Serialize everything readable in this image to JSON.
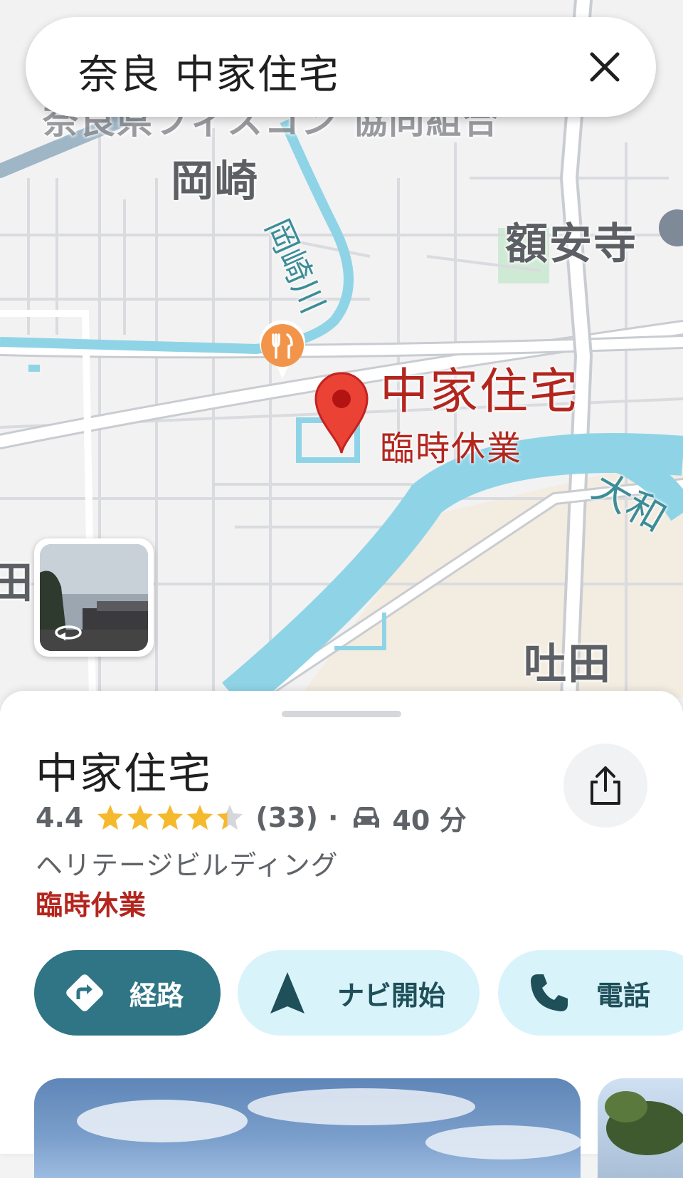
{
  "search": {
    "query": "奈良 中家住宅"
  },
  "map": {
    "labels": {
      "okazaki": "岡崎",
      "okazaki_river": "岡崎川",
      "gakuanji": "額安寺",
      "place_name": "中家住宅",
      "place_status": "臨時休業",
      "yamato_river": "大和",
      "handa": "吐田",
      "edge_left": "田",
      "top_fragment": "奈良県フィスコン 協同組合"
    },
    "colors": {
      "water": "#8fd4e6",
      "road": "#ffffff",
      "pin": "#ea4335",
      "restaurant": "#f2954b",
      "park": "#cfead4"
    }
  },
  "place": {
    "name": "中家住宅",
    "rating": "4.4",
    "rating_value": 4.4,
    "reviews": "(33)",
    "separator": "·",
    "travel_time": "40 分",
    "category": "ヘリテージビルディング",
    "status": "臨時休業"
  },
  "actions": {
    "route": "経路",
    "navigate": "ナビ開始",
    "call": "電話"
  },
  "icons": [
    "close-icon",
    "restaurant-icon",
    "map-pin-icon",
    "street-view-rotate-icon",
    "share-icon",
    "star-icon",
    "car-icon",
    "directions-icon",
    "navigation-arrow-icon",
    "phone-icon"
  ]
}
